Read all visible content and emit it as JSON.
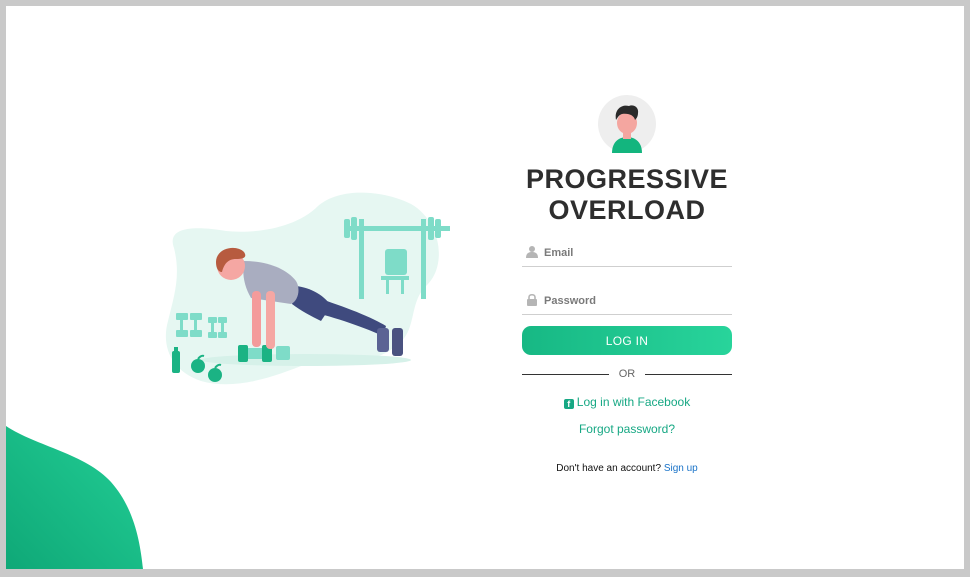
{
  "app": {
    "title": "PROGRESSIVE OVERLOAD"
  },
  "colors": {
    "accent": "#1fc48f",
    "accent_dark": "#17a884",
    "link_blue": "#1a73c8",
    "illustration_mint": "#7edcc8",
    "text_dark": "#2e2e2e"
  },
  "illustration": {
    "description_icon": "pushup-workout-illustration"
  },
  "login": {
    "email_placeholder": "Email",
    "email_value": "",
    "password_placeholder": "Password",
    "password_value": "",
    "submit_label": "LOG IN",
    "divider_label": "OR",
    "facebook_label": "Log in with Facebook",
    "forgot_label": "Forgot password?",
    "signup_prompt": "Don't have an account?",
    "signup_label": "Sign up"
  },
  "icons": {
    "avatar": "user-avatar-icon",
    "email": "user-icon",
    "password": "lock-icon",
    "facebook": "facebook-icon"
  }
}
